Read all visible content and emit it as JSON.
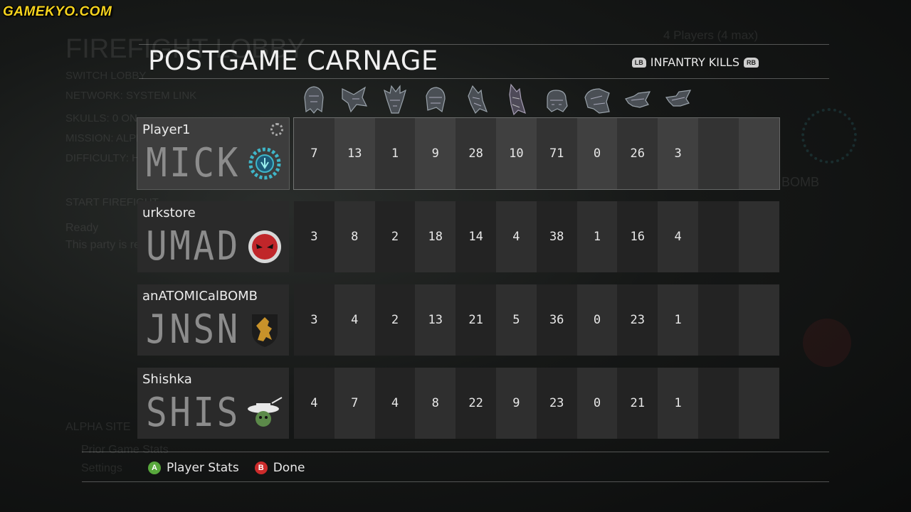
{
  "watermark": "GAMEKYO.COM",
  "background": {
    "lobby_title": "FIREFIGHT LOBBY",
    "player_count": "4 Players (4 max)",
    "menu_lines": [
      "SWITCH LOBBY",
      "NETWORK: SYSTEM LINK",
      "SKULLS: 0 ON",
      "MISSION: ALPHA SITE",
      "DIFFICULTY: HEROIC",
      "START FIREFIGHT",
      "Ready",
      "This party is ready to go."
    ],
    "bottom_lines": [
      "ALPHA SITE",
      "Prior Game Stats",
      "Settings"
    ],
    "side_text": "BOMB"
  },
  "header": {
    "title": "POSTGAME CARNAGE",
    "left_bumper": "LB",
    "category": "INFANTRY KILLS",
    "right_bumper": "RB"
  },
  "enemy_columns": [
    "grunt-icon",
    "jackal-icon",
    "skirmisher-icon",
    "drone-icon",
    "elite-icon",
    "elite-ranger-icon",
    "brute-icon",
    "hunter-icon",
    "engineer-icon",
    "skirmisher-commando-icon"
  ],
  "players": [
    {
      "gamertag": "Player1",
      "service_tag": "MICK",
      "emblem": "gear-emblem-icon",
      "selected": true,
      "stats": [
        "7",
        "13",
        "1",
        "9",
        "28",
        "10",
        "71",
        "0",
        "26",
        "3",
        "",
        ""
      ]
    },
    {
      "gamertag": "urkstore",
      "service_tag": "UMAD",
      "emblem": "angry-face-emblem-icon",
      "selected": false,
      "stats": [
        "3",
        "8",
        "2",
        "18",
        "14",
        "4",
        "38",
        "1",
        "16",
        "4",
        "",
        ""
      ]
    },
    {
      "gamertag": "anATOMICalBOMB",
      "service_tag": "JNSN",
      "emblem": "lion-shield-emblem-icon",
      "selected": false,
      "stats": [
        "3",
        "4",
        "2",
        "13",
        "21",
        "5",
        "36",
        "0",
        "23",
        "1",
        "",
        ""
      ]
    },
    {
      "gamertag": "Shishka",
      "service_tag": "SHIS",
      "emblem": "hat-emblem-icon",
      "selected": false,
      "stats": [
        "4",
        "7",
        "4",
        "8",
        "22",
        "9",
        "23",
        "0",
        "21",
        "1",
        "",
        ""
      ]
    }
  ],
  "footer": {
    "a_glyph": "A",
    "a_label": "Player Stats",
    "b_glyph": "B",
    "b_label": "Done"
  },
  "colors": {
    "a_button": "#58a83c",
    "b_button": "#cc2b2b",
    "watermark": "#f5d31e"
  }
}
